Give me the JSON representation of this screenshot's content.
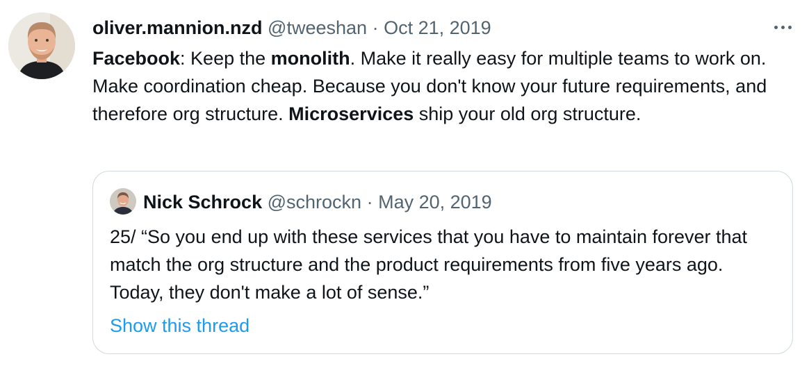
{
  "tweet": {
    "display_name": "oliver.mannion.nzd",
    "handle": "@tweeshan",
    "separator": "·",
    "date": "Oct 21, 2019",
    "text": {
      "p1_bold": "Facebook",
      "p2": ": Keep the ",
      "p3_bold": "monolith",
      "p4": ". Make it really easy for multiple teams to work on. Make coordination cheap. Because you don't know your future requirements, and therefore org structure. ",
      "p5_bold": "Microservices",
      "p6": " ship your old org structure."
    }
  },
  "quoted": {
    "display_name": "Nick Schrock",
    "handle": "@schrockn",
    "separator": "·",
    "date": "May 20, 2019",
    "text": "25/ “So you end up with these services that you have to maintain forever that match the org structure and the product requirements from five years ago. Today, they don't make a lot of sense.”",
    "link": "Show this thread"
  },
  "colors": {
    "text_primary": "#0f1419",
    "text_secondary": "#536471",
    "link": "#1d9bf0",
    "border": "#cfd9de"
  },
  "icons": {
    "more": "more-horizontal-icon"
  }
}
